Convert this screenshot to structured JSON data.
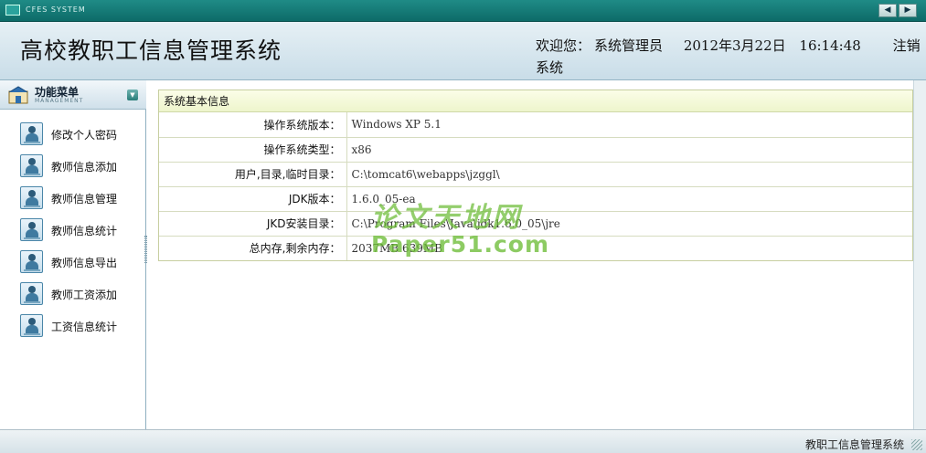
{
  "sysbar": {
    "logo_text": "CFES SYSTEM",
    "prev_icon": "triangle-left-icon",
    "next_icon": "triangle-right-icon"
  },
  "header": {
    "title": "高校教职工信息管理系统",
    "welcome_label": "欢迎您：",
    "user_name": "系统管理员",
    "date": "2012年3月22日",
    "time": "16:14:48",
    "logout": "注销系统"
  },
  "menu": {
    "title": "功能菜单",
    "subtitle": "MANAGEMENT",
    "items": [
      {
        "label": "修改个人密码"
      },
      {
        "label": "教师信息添加"
      },
      {
        "label": "教师信息管理"
      },
      {
        "label": "教师信息统计"
      },
      {
        "label": "教师信息导出"
      },
      {
        "label": "教师工资添加"
      },
      {
        "label": "工资信息统计"
      }
    ]
  },
  "info": {
    "caption": "系统基本信息",
    "rows": [
      {
        "key": "操作系统版本：",
        "value": "Windows XP  5.1"
      },
      {
        "key": "操作系统类型：",
        "value": "x86"
      },
      {
        "key": "用户,目录,临时目录：",
        "value": "C:\\tomcat6\\webapps\\jzggl\\"
      },
      {
        "key": "JDK版本：",
        "value": "1.6.0_05-ea"
      },
      {
        "key": "JKD安装目录：",
        "value": "C:\\Program Files\\Java\\jdk1.6.0_05\\jre"
      },
      {
        "key": "总内存,剩余内存：",
        "value": "2037MB   639MB"
      }
    ]
  },
  "watermark": {
    "line1": "论文天地网",
    "line2": "Paper51.com"
  },
  "footer": {
    "text": "教职工信息管理系统"
  },
  "colors": {
    "titlebar": "#0d6b68",
    "header_bg": "#c9dde8",
    "caption_bg": "#eef5cc",
    "watermark": "#70be3c"
  }
}
